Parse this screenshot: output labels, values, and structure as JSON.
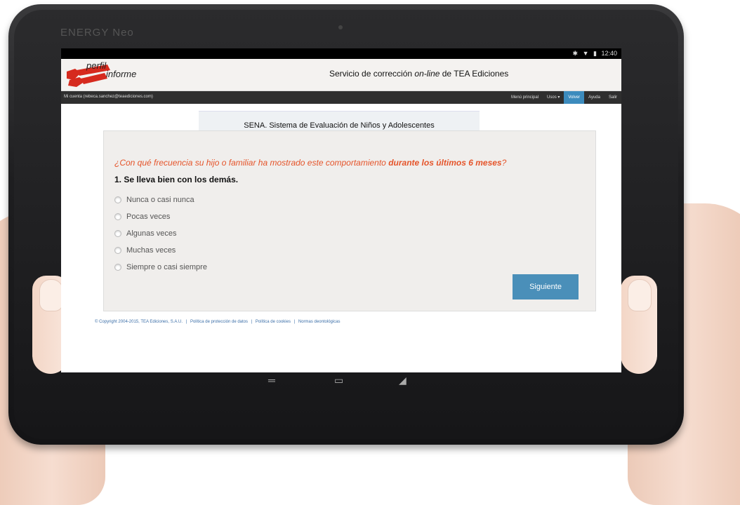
{
  "device": {
    "brand": "ENERGY Neo",
    "clock": "12:40"
  },
  "header": {
    "logo_perfil": "perfil",
    "logo_informe": "informe",
    "title_prefix": "Servicio de corrección ",
    "title_italic": "on-line",
    "title_suffix": " de TEA Ediciones"
  },
  "navbar": {
    "account": "Mi cuenta (rebeca.sanchez@teaediciones.com)",
    "menu": [
      {
        "label": "Menú principal",
        "active": false
      },
      {
        "label": "Usos ▾",
        "active": false
      },
      {
        "label": "Volver",
        "active": true
      },
      {
        "label": "Ayuda",
        "active": false
      },
      {
        "label": "Salir",
        "active": false
      }
    ]
  },
  "test": {
    "title": "SENA. Sistema de Evaluación de Niños y Adolescentes",
    "prompt_start": "¿Con qué frecuencia su hijo o familiar ha mostrado este comportamiento ",
    "prompt_bold": "durante los últimos 6 meses",
    "prompt_end": "?",
    "item": "1. Se lleva bien con los demás.",
    "options": [
      "Nunca o casi nunca",
      "Pocas veces",
      "Algunas veces",
      "Muchas veces",
      "Siempre o casi siempre"
    ],
    "next_label": "Siguiente"
  },
  "footer": {
    "copyright": "© Copyright 2004-2015, TEA Ediciones, S.A.U.",
    "links": [
      "Política de protección de datos",
      "Política de cookies",
      "Normas deontológicas"
    ]
  },
  "colors": {
    "accent": "#4a8fb9",
    "prompt": "#e5542a",
    "logo_red": "#d62a1e"
  }
}
